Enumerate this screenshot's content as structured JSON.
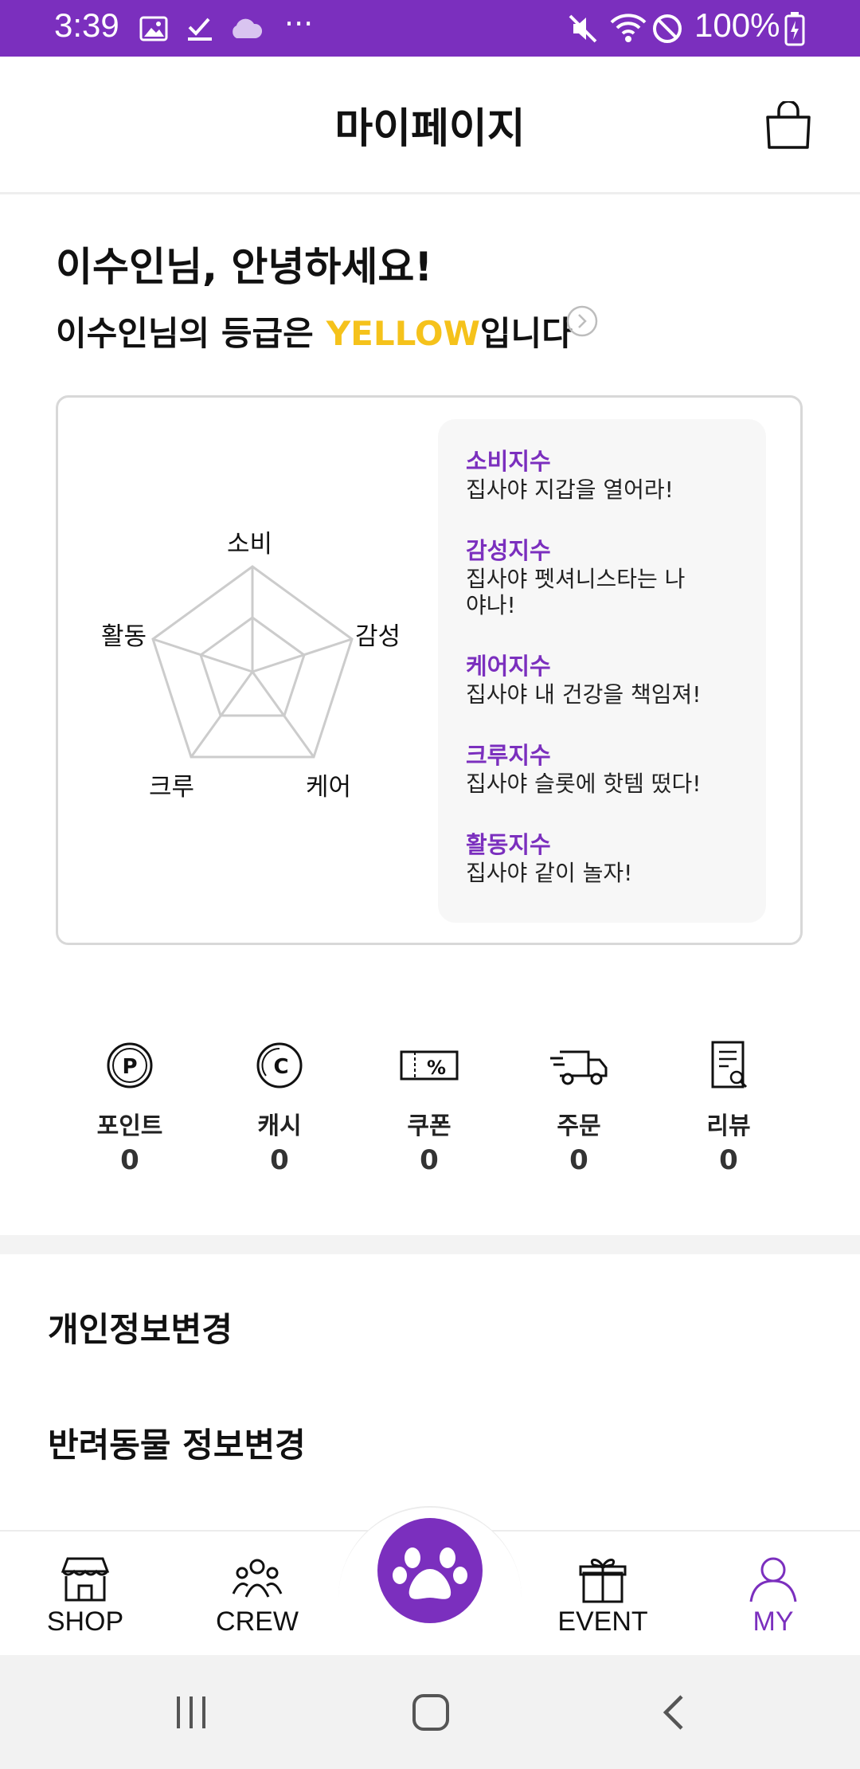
{
  "status_bar": {
    "time": "3:39",
    "battery": "100%"
  },
  "header": {
    "title": "마이페이지"
  },
  "greeting": {
    "hello": "이수인님, 안녕하세요!",
    "grade_prefix": "이수인님의 등급은",
    "grade_value": "YELLOW",
    "grade_suffix": "입니다"
  },
  "radar": {
    "labels": [
      "소비",
      "감성",
      "케어",
      "크루",
      "활동"
    ]
  },
  "indices": [
    {
      "title": "소비지수",
      "desc": "집사야 지갑을 열어라!"
    },
    {
      "title": "감성지수",
      "desc": "집사야 펫셔니스타는 나야나!"
    },
    {
      "title": "케어지수",
      "desc": "집사야 내 건강을 책임져!"
    },
    {
      "title": "크루지수",
      "desc": "집사야 슬롯에 핫템 떴다!"
    },
    {
      "title": "활동지수",
      "desc": "집사야 같이 놀자!"
    }
  ],
  "stats": [
    {
      "label": "포인트",
      "value": "0",
      "icon": "point-icon"
    },
    {
      "label": "캐시",
      "value": "0",
      "icon": "cash-icon"
    },
    {
      "label": "쿠폰",
      "value": "0",
      "icon": "coupon-icon"
    },
    {
      "label": "주문",
      "value": "0",
      "icon": "delivery-truck-icon"
    },
    {
      "label": "리뷰",
      "value": "0",
      "icon": "review-icon"
    }
  ],
  "menu": [
    "개인정보변경",
    "반려동물 정보변경"
  ],
  "tabs": [
    {
      "label": "SHOP",
      "icon": "shop-icon"
    },
    {
      "label": "CREW",
      "icon": "crew-icon"
    },
    {
      "label": "",
      "icon": "paw-icon"
    },
    {
      "label": "EVENT",
      "icon": "gift-icon"
    },
    {
      "label": "MY",
      "icon": "person-icon",
      "active": true
    }
  ],
  "colors": {
    "brand": "#7B2FBE",
    "grade_yellow": "#F5C21B"
  }
}
